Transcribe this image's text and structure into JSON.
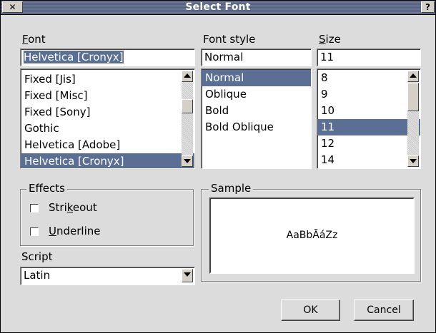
{
  "window": {
    "title": "Select Font",
    "close_glyph": "✕",
    "help_glyph": "?"
  },
  "font": {
    "label": "Font",
    "value": "Helvetica [Cronyx]",
    "items": [
      "Fixed [Jis]",
      "Fixed [Misc]",
      "Fixed [Sony]",
      "Gothic",
      "Helvetica [Adobe]",
      "Helvetica [Cronyx]"
    ],
    "selected": "Helvetica [Cronyx]"
  },
  "style": {
    "label": "Font style",
    "value": "Normal",
    "items": [
      "Normal",
      "Oblique",
      "Bold",
      "Bold Oblique"
    ],
    "selected": "Normal"
  },
  "size": {
    "label": "Size",
    "value": "11",
    "items": [
      "8",
      "9",
      "10",
      "11",
      "12",
      "14"
    ],
    "selected": "11"
  },
  "effects": {
    "legend": "Effects",
    "strikeout": {
      "pre": "Stri",
      "ul": "k",
      "post": "eout"
    },
    "underline": {
      "pre": "",
      "ul": "U",
      "post": "nderline"
    }
  },
  "sample": {
    "legend": "Sample",
    "text": "AaBbÃáZz"
  },
  "script": {
    "label": "Script",
    "value": "Latin"
  },
  "buttons": {
    "ok": "OK",
    "cancel": "Cancel"
  },
  "colors": {
    "selection": "#5b6f94",
    "titlebar": "#5f6b86"
  }
}
